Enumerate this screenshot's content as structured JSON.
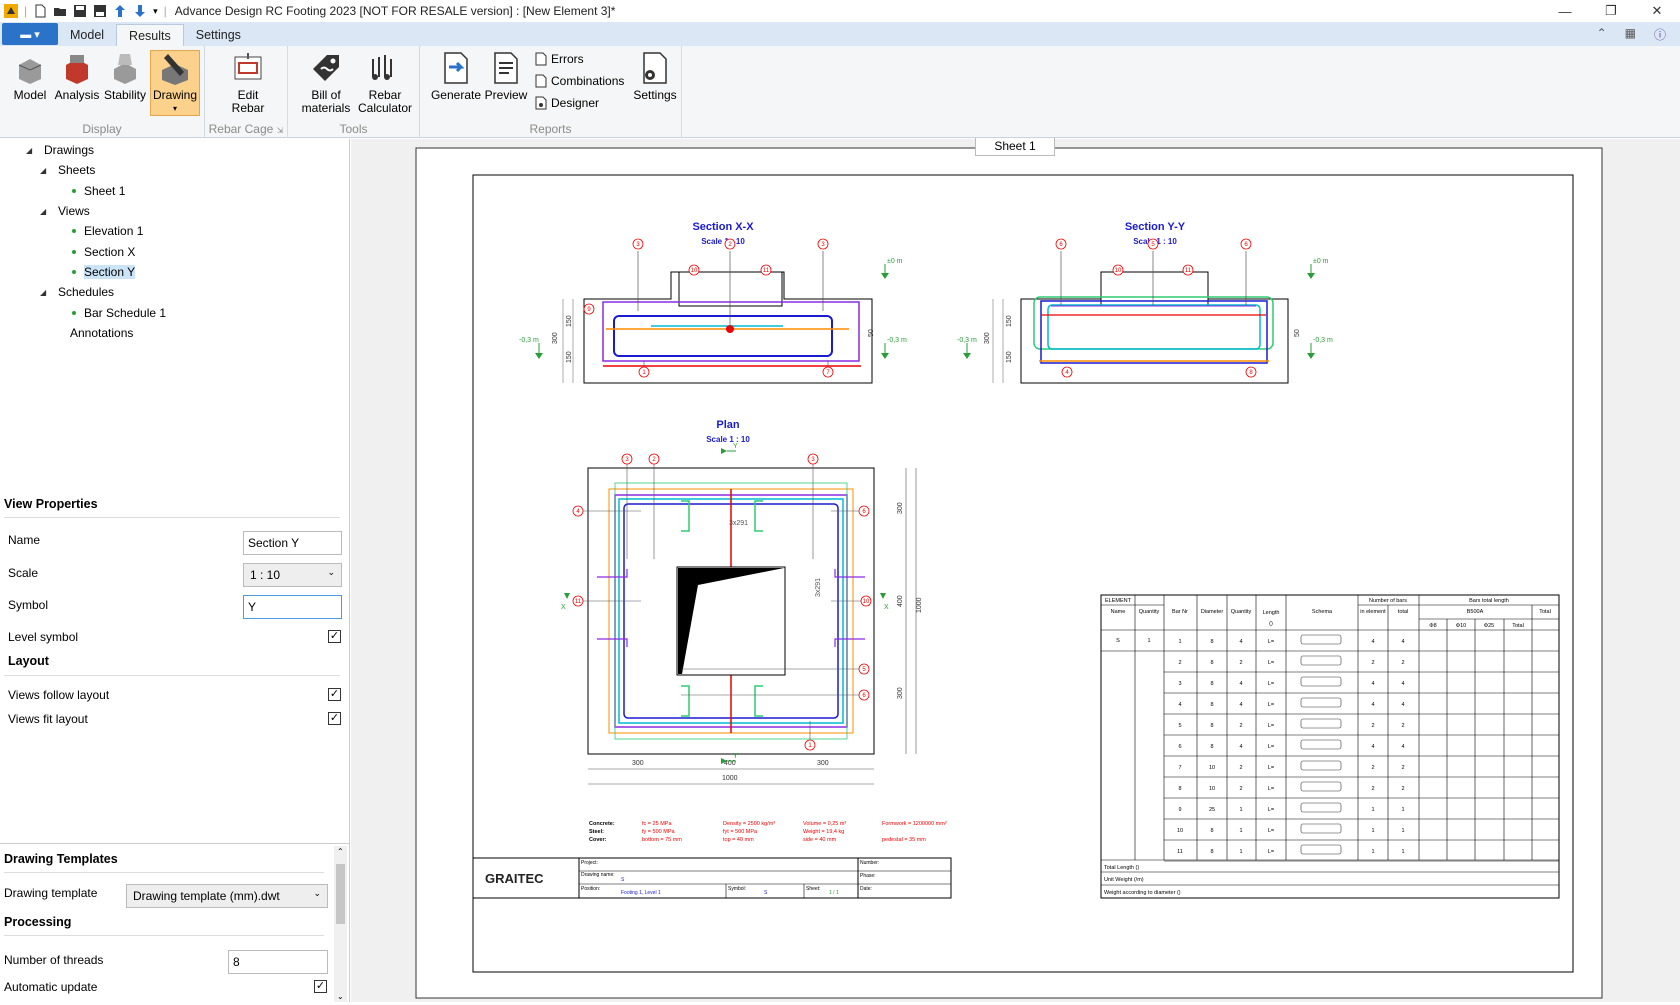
{
  "titlebar": {
    "title": "Advance Design RC Footing 2023 [NOT FOR RESALE version] : [New Element 3]*"
  },
  "tabs": [
    "Model",
    "Results",
    "Settings"
  ],
  "ribbon": {
    "display": {
      "label": "Display",
      "buttons": [
        "Model",
        "Analysis",
        "Stability",
        "Drawing"
      ]
    },
    "rebar_cage": {
      "label": "Rebar Cage",
      "button_line1": "Edit",
      "button_line2": "Rebar"
    },
    "tools": {
      "label": "Tools",
      "bom_line1": "Bill of",
      "bom_line2": "materials",
      "calc_line1": "Rebar",
      "calc_line2": "Calculator"
    },
    "reports": {
      "label": "Reports",
      "generate": "Generate",
      "preview": "Preview",
      "errors": "Errors",
      "combinations": "Combinations",
      "designer": "Designer",
      "settings": "Settings"
    }
  },
  "tree": {
    "drawings": "Drawings",
    "sheets": "Sheets",
    "sheet1": "Sheet 1",
    "views": "Views",
    "elevation1": "Elevation 1",
    "sectionx": "Section X",
    "sectiony": "Section Y",
    "schedules": "Schedules",
    "barschedule1": "Bar Schedule 1",
    "annotations": "Annotations"
  },
  "view_properties": {
    "header": "View Properties",
    "name_label": "Name",
    "name_value": "Section Y",
    "scale_label": "Scale",
    "scale_value": "1 : 10",
    "symbol_label": "Symbol",
    "symbol_value": "Y",
    "level_symbol_label": "Level symbol",
    "layout_header": "Layout",
    "views_follow_label": "Views follow layout",
    "views_fit_label": "Views fit layout"
  },
  "drawing_templates": {
    "header": "Drawing Templates",
    "template_label": "Drawing template",
    "template_value": "Drawing template (mm).dwt",
    "processing_header": "Processing",
    "threads_label": "Number of threads",
    "threads_value": "8",
    "auto_update_label": "Automatic update"
  },
  "sheet": {
    "tab": "Sheet 1",
    "section_xx": {
      "title": "Section X-X",
      "scale": "Scale 1 : 10"
    },
    "section_yy": {
      "title": "Section Y-Y",
      "scale": "Scale 1 : 10"
    },
    "plan": {
      "title": "Plan",
      "scale": "Scale 1 : 10"
    },
    "levels": {
      "top": "±0 m",
      "bottom": "-0,3 m"
    },
    "dims": {
      "d300": "300",
      "d150": "150",
      "d50": "50",
      "d400": "400",
      "d1000": "1000",
      "d3x291": "3x291"
    },
    "marks": {
      "X": "X",
      "Y": "Y"
    },
    "bubbles": {
      "b1": "1",
      "b2": "2",
      "b3": "3",
      "b4": "4",
      "b5": "5",
      "b6": "6",
      "b7": "7",
      "b8": "8",
      "b9": "9",
      "b10": "10",
      "b11": "11"
    },
    "materials": {
      "concrete": "Concrete:",
      "steel": "Steel:",
      "cover": "Cover:",
      "fc": "fc = 25 MPa",
      "fy": "fy = 500 MPa",
      "bottom": "bottom = 75 mm",
      "density": "Density = 2500 kg/m³",
      "fyt": "fyt = 500 MPa",
      "top": "top = 40 mm",
      "volume": "Volume = 0,25 m³",
      "weight": "Weight = 19,4 kg",
      "side": "side = 40 mm",
      "formwork": "Formwork = 1200000 mm²",
      "pedestal": "pedestal = 35 mm"
    },
    "cartouche": {
      "logo": "GRAITEC",
      "project": "Project:",
      "number": "Number:",
      "drawing_name": "Drawing name:",
      "drawing_name_val": "S",
      "phase": "Phase:",
      "position": "Position:",
      "position_val": "Footing 1, Level 1",
      "symbol": "Symbol:",
      "symbol_val": "S",
      "sheet": "Sheet:",
      "sheet_val": "1 / 1",
      "date": "Date:"
    }
  },
  "schedule": {
    "h_element": "ELEMENT",
    "h_name": "Name",
    "h_qty": "Quantity",
    "h_barnr": "Bar Nr",
    "h_diam": "Diameter",
    "h_quantity": "Quantity",
    "h_length": "Length",
    "h_length_unit": "()",
    "h_schema": "Schema",
    "h_nbars": "Number of bars",
    "h_inel": "in element",
    "h_total": "total",
    "h_btl": "Bars total length",
    "h_steel": "B500A",
    "h_total2": "Total",
    "h_d8": "Φ8",
    "h_d10": "Φ10",
    "h_d25": "Φ25",
    "h_total3": "Total",
    "el_name": "S",
    "el_qty": "1",
    "rows": [
      {
        "nr": "1",
        "d": "8",
        "q": "4",
        "l": "L=",
        "ie": "4",
        "t": "4"
      },
      {
        "nr": "2",
        "d": "8",
        "q": "2",
        "l": "L=",
        "ie": "2",
        "t": "2"
      },
      {
        "nr": "3",
        "d": "8",
        "q": "4",
        "l": "L=",
        "ie": "4",
        "t": "4"
      },
      {
        "nr": "4",
        "d": "8",
        "q": "4",
        "l": "L=",
        "ie": "4",
        "t": "4"
      },
      {
        "nr": "5",
        "d": "8",
        "q": "2",
        "l": "L=",
        "ie": "2",
        "t": "2"
      },
      {
        "nr": "6",
        "d": "8",
        "q": "4",
        "l": "L=",
        "ie": "4",
        "t": "4"
      },
      {
        "nr": "7",
        "d": "10",
        "q": "2",
        "l": "L=",
        "ie": "2",
        "t": "2"
      },
      {
        "nr": "8",
        "d": "10",
        "q": "2",
        "l": "L=",
        "ie": "2",
        "t": "2"
      },
      {
        "nr": "9",
        "d": "25",
        "q": "1",
        "l": "L=",
        "ie": "1",
        "t": "1"
      },
      {
        "nr": "10",
        "d": "8",
        "q": "1",
        "l": "L=",
        "ie": "1",
        "t": "1"
      },
      {
        "nr": "11",
        "d": "8",
        "q": "1",
        "l": "L=",
        "ie": "1",
        "t": "1"
      }
    ],
    "total_length": "Total Length ()",
    "unit_weight": "Unit Weight (/m)",
    "weight_diam": "Weight according to diameter ()"
  }
}
